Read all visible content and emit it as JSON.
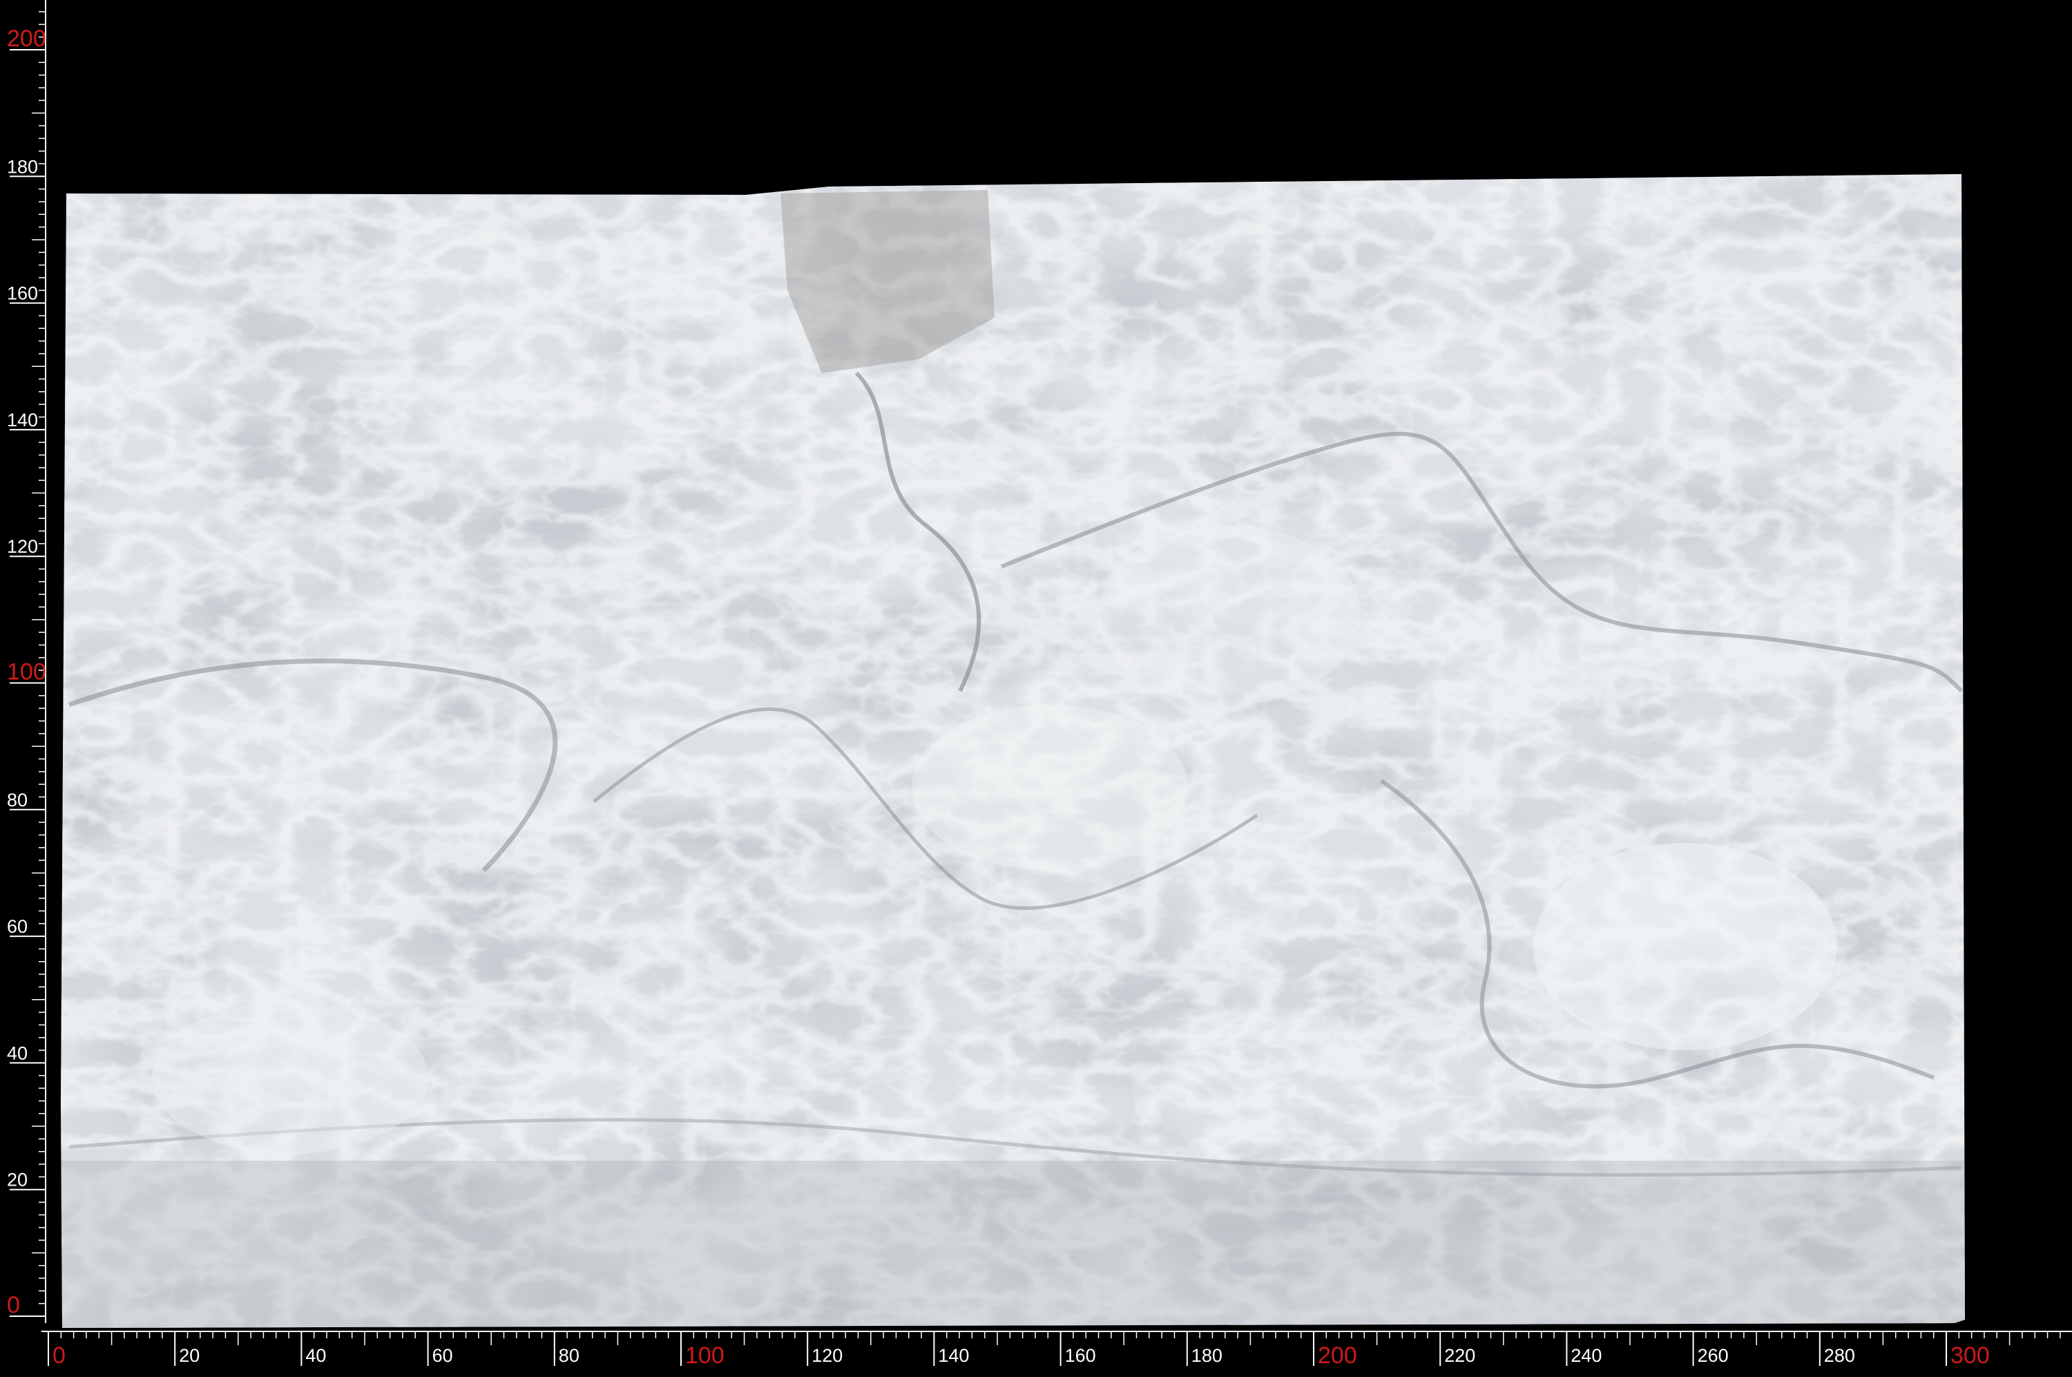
{
  "image": {
    "subject": "marble-slab",
    "colors": {
      "background": "#000000",
      "ruler_line": "#ffffff",
      "major_label": "#d11a1a",
      "minor_label": "#ffffff",
      "marble_base": "#dfe2e5",
      "marble_vein": "#8f969f",
      "marble_light": "#f2f4f6"
    }
  },
  "y_ruler": {
    "labels": [
      "0",
      "20",
      "40",
      "60",
      "80",
      "100",
      "120",
      "140",
      "160",
      "180",
      "200"
    ],
    "values": [
      0,
      20,
      40,
      60,
      80,
      100,
      120,
      140,
      160,
      180,
      200
    ],
    "major_values": [
      0,
      100,
      200
    ]
  },
  "x_ruler": {
    "labels": [
      "0",
      "20",
      "40",
      "60",
      "80",
      "100",
      "120",
      "140",
      "160",
      "180",
      "200",
      "220",
      "240",
      "260",
      "280",
      "300"
    ],
    "values": [
      0,
      20,
      40,
      60,
      80,
      100,
      120,
      140,
      160,
      180,
      200,
      220,
      240,
      260,
      280,
      300
    ],
    "major_values": [
      0,
      100,
      200,
      300
    ]
  }
}
